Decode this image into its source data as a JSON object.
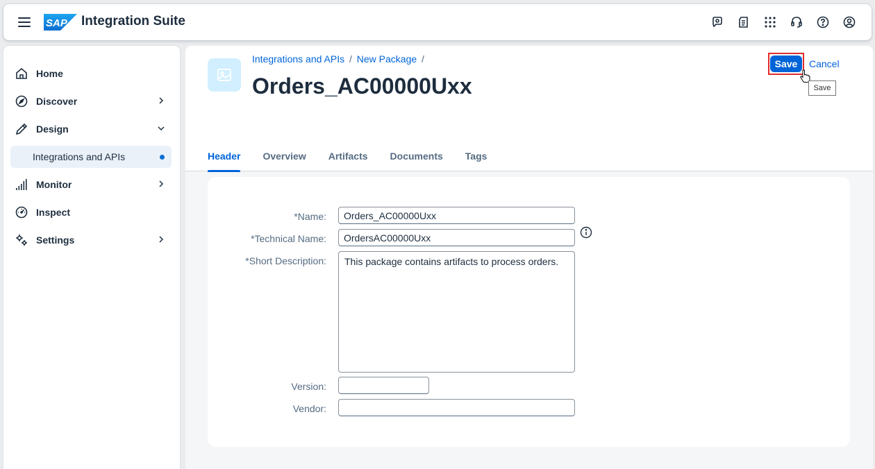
{
  "shell": {
    "brand_logo_text": "SAP",
    "app_title": "Integration Suite",
    "icons": [
      "assistant-icon",
      "whats-new-icon",
      "product-switch-icon",
      "support-icon",
      "help-icon",
      "user-profile-icon"
    ]
  },
  "sidebar": {
    "items": [
      {
        "label": "Home",
        "icon": "home-icon"
      },
      {
        "label": "Discover",
        "icon": "compass-icon"
      },
      {
        "label": "Design",
        "icon": "pencil-icon"
      },
      {
        "label": "Integrations and APIs",
        "icon": "",
        "selected": true
      },
      {
        "label": "Monitor",
        "icon": "bar-chart-icon"
      },
      {
        "label": "Inspect",
        "icon": "gauge-icon"
      },
      {
        "label": "Settings",
        "icon": "gears-icon"
      }
    ]
  },
  "page": {
    "breadcrumb": [
      "Integrations and APIs",
      "New Package"
    ],
    "breadcrumb_sep": "/",
    "title": "Orders_AC00000Uxx",
    "save_label": "Save",
    "cancel_label": "Cancel",
    "tooltip": "Save"
  },
  "tabs": [
    "Header",
    "Overview",
    "Artifacts",
    "Documents",
    "Tags"
  ],
  "form": {
    "name_label": "*Name:",
    "name_value": "Orders_AC00000Uxx",
    "tech_label": "*Technical Name:",
    "tech_value": "OrdersAC00000Uxx",
    "desc_label": "*Short Description:",
    "desc_value": "This package contains artifacts to process orders.",
    "version_label": "Version:",
    "version_value": "",
    "vendor_label": "Vendor:",
    "vendor_value": ""
  },
  "colors": {
    "accent": "#0064d9",
    "highlight_border": "#e02b2b",
    "selected_nav_bg": "#eaf1f9"
  }
}
